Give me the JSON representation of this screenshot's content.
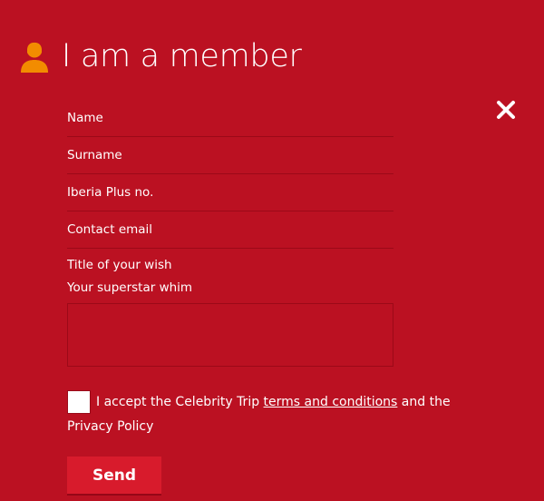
{
  "header": {
    "title": "I am a member",
    "icon": "member-icon",
    "icon_color": "#f28c00"
  },
  "close": {
    "icon": "close-icon"
  },
  "form": {
    "fields": [
      {
        "placeholder": "Name",
        "value": ""
      },
      {
        "placeholder": "Surname",
        "value": ""
      },
      {
        "placeholder": "Iberia Plus no.",
        "value": ""
      },
      {
        "placeholder": "Contact email",
        "value": ""
      },
      {
        "placeholder": "Title of your wish",
        "value": ""
      }
    ],
    "textarea_label": "Your superstar whim",
    "textarea_value": ""
  },
  "consent": {
    "text_before": "I accept the Celebrity Trip ",
    "link_text": "terms and conditions",
    "text_after": " and the Privacy Policy",
    "checked": false
  },
  "actions": {
    "send_label": "Send"
  },
  "colors": {
    "background": "#bb1122",
    "button": "#d81b2c",
    "accent": "#f28c00"
  }
}
